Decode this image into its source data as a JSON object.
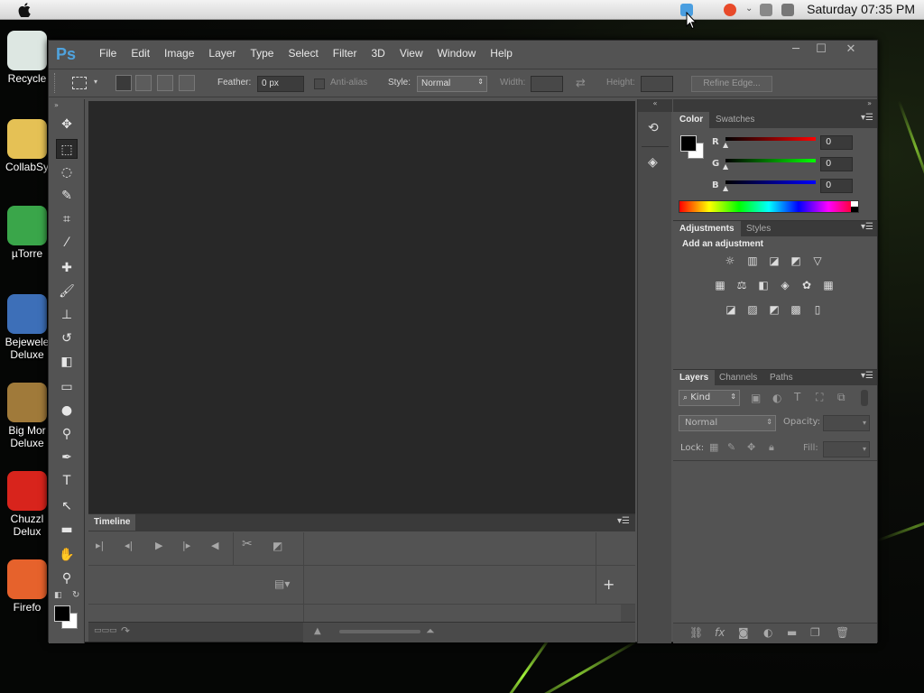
{
  "menubar": {
    "clock": "Saturday 07:35 PM"
  },
  "desktop": {
    "icons": [
      {
        "label": "Recycle",
        "name": "recycle-bin-icon",
        "color": "#dde7e2"
      },
      {
        "label": "CollabSy",
        "name": "collabsync-icon",
        "color": "#e5c155"
      },
      {
        "label": "µTorre",
        "name": "utorrent-icon",
        "color": "#3aa64a"
      },
      {
        "label": "Bejewele\nDeluxe",
        "name": "bejeweled-icon",
        "color": "#3d6fb8"
      },
      {
        "label": "Big Mor\nDeluxe",
        "name": "big-money-icon",
        "color": "#a07a3a"
      },
      {
        "label": "Chuzzl\nDelux",
        "name": "chuzzle-icon",
        "color": "#d8241c"
      },
      {
        "label": "Firefo",
        "name": "firefox-icon",
        "color": "#e6622c"
      }
    ]
  },
  "app": {
    "logo": "Ps",
    "menu": [
      "File",
      "Edit",
      "Image",
      "Layer",
      "Type",
      "Select",
      "Filter",
      "3D",
      "View",
      "Window",
      "Help"
    ]
  },
  "options": {
    "feather_label": "Feather:",
    "feather_value": "0 px",
    "antialias_label": "Anti-alias",
    "style_label": "Style:",
    "style_value": "Normal",
    "width_label": "Width:",
    "height_label": "Height:",
    "refine_button": "Refine Edge..."
  },
  "timeline": {
    "tab": "Timeline"
  },
  "color_panel": {
    "tabs": [
      "Color",
      "Swatches"
    ],
    "r_label": "R",
    "g_label": "G",
    "b_label": "B",
    "r_value": "0",
    "g_value": "0",
    "b_value": "0"
  },
  "adjustments_panel": {
    "tabs": [
      "Adjustments",
      "Styles"
    ],
    "heading": "Add an adjustment"
  },
  "layers_panel": {
    "tabs": [
      "Layers",
      "Channels",
      "Paths"
    ],
    "kind_value": "Kind",
    "blend_value": "Normal",
    "opacity_label": "Opacity:",
    "lock_label": "Lock:",
    "fill_label": "Fill:"
  },
  "colors": {
    "accent": "#4fa3de",
    "bg_panel": "#535353",
    "canvas": "#282828"
  }
}
